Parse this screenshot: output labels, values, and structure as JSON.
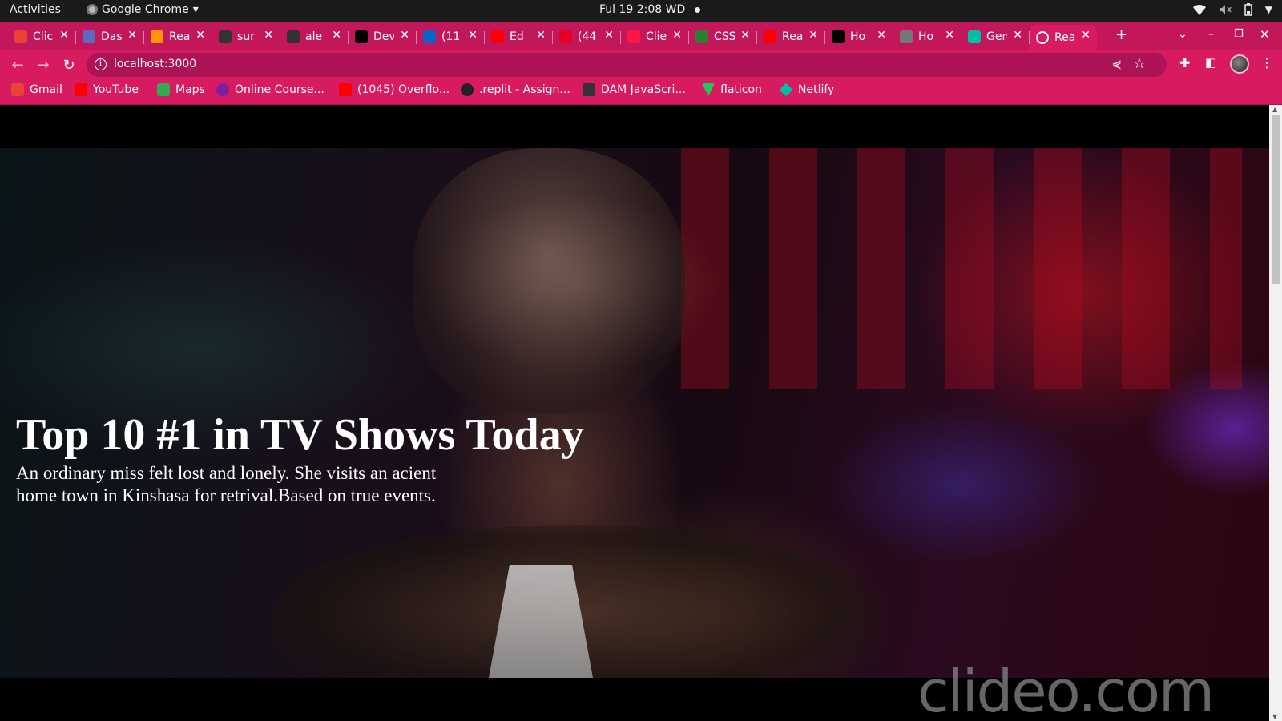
{
  "os_bar": {
    "activities": "Activities",
    "app_name": "Google Chrome",
    "clock": "Ful 19  2:08 WD"
  },
  "tabs": [
    {
      "title": "Clic",
      "favicon": "gmail-icon",
      "color": "#ea4335"
    },
    {
      "title": "Das",
      "favicon": "shield-icon",
      "color": "#5c6bc0"
    },
    {
      "title": "Rea",
      "favicon": "shield-icon",
      "color": "#ff9800"
    },
    {
      "title": "sur",
      "favicon": "github-icon",
      "color": "#333333"
    },
    {
      "title": "ale",
      "favicon": "github-icon",
      "color": "#333333"
    },
    {
      "title": "Dev",
      "favicon": "triangle-icon",
      "color": "#000000"
    },
    {
      "title": "(11",
      "favicon": "linkedin-icon",
      "color": "#0a66c2"
    },
    {
      "title": "Ed",
      "favicon": "youtube-icon",
      "color": "#ff0000"
    },
    {
      "title": "(44",
      "favicon": "pinterest-icon",
      "color": "#e60023"
    },
    {
      "title": "Clie",
      "favicon": "circle-icon",
      "color": "#ff1744"
    },
    {
      "title": "CSS",
      "favicon": "w-icon",
      "color": "#2e7d32"
    },
    {
      "title": "Rea",
      "favicon": "youtube-icon",
      "color": "#ff0000"
    },
    {
      "title": "Ho",
      "favicon": "notion-icon",
      "color": "#000000"
    },
    {
      "title": "Ho",
      "favicon": "cube-icon",
      "color": "#777777"
    },
    {
      "title": "Gen",
      "favicon": "netlify-icon",
      "color": "#00bfa5"
    },
    {
      "title": "Rea",
      "favicon": "globe-icon",
      "color": "#ffffff",
      "active": true
    }
  ],
  "address_bar": {
    "url": "localhost:3000"
  },
  "bookmarks": [
    {
      "label": "Gmail",
      "icon": "gmail-icon",
      "color": "#ea4335"
    },
    {
      "label": "YouTube",
      "icon": "youtube-icon",
      "color": "#ff0000"
    },
    {
      "label": "Maps",
      "icon": "maps-icon",
      "color": "#34a853"
    },
    {
      "label": "Online Course...",
      "icon": "course-icon",
      "color": "#7b1fa2"
    },
    {
      "label": "(1045) Overflo...",
      "icon": "youtube-icon",
      "color": "#ff0000"
    },
    {
      "label": ".replit - Assign...",
      "icon": "replit-icon",
      "color": "#222222"
    },
    {
      "label": "DAM JavaScri...",
      "icon": "person-icon",
      "color": "#333333"
    },
    {
      "label": "flaticon",
      "icon": "flaticon-icon",
      "color": "#22c55e"
    },
    {
      "label": "Netlify",
      "icon": "netlify-icon",
      "color": "#00bfa5"
    }
  ],
  "hero": {
    "title": "Top 10 #1 in TV Shows Today",
    "description": "An ordinary miss felt lost and lonely. She visits an acient home town in Kinshasa for retrival.Based on true events."
  },
  "watermark": "clideo.com",
  "colors": {
    "chrome_theme": "#d81b60",
    "tab_strip": "#c2185b",
    "omnibox": "#ad1457"
  }
}
